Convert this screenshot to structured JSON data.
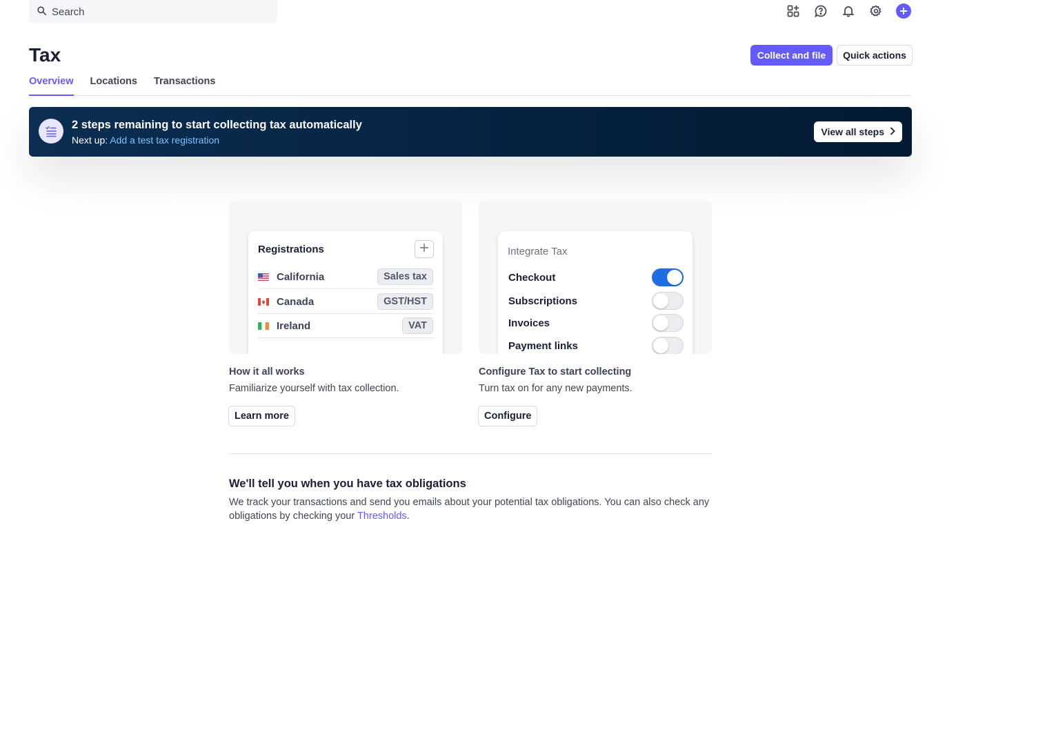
{
  "search": {
    "placeholder": "Search"
  },
  "top_icons": [
    "apps-add-icon",
    "help-icon",
    "bell-icon",
    "gear-icon",
    "plus-circle-icon"
  ],
  "header": {
    "title": "Tax",
    "primary_button": "Collect and file",
    "secondary_button": "Quick actions"
  },
  "tabs": [
    {
      "label": "Overview",
      "active": true
    },
    {
      "label": "Locations",
      "active": false
    },
    {
      "label": "Transactions",
      "active": false
    }
  ],
  "banner": {
    "title": "2 steps remaining to start collecting tax automatically",
    "next_prefix": "Next up: ",
    "next_link": "Add a test tax registration",
    "button": "View all steps"
  },
  "registrations": {
    "title": "Registrations",
    "rows": [
      {
        "name": "California",
        "tag": "Sales tax",
        "flag": "us"
      },
      {
        "name": "Canada",
        "tag": "GST/HST",
        "flag": "ca"
      },
      {
        "name": "Ireland",
        "tag": "VAT",
        "flag": "ie"
      }
    ]
  },
  "integrate": {
    "title": "Integrate Tax",
    "rows": [
      {
        "label": "Checkout",
        "on": true
      },
      {
        "label": "Subscriptions",
        "on": false
      },
      {
        "label": "Invoices",
        "on": false
      },
      {
        "label": "Payment links",
        "on": false
      }
    ]
  },
  "cards": {
    "left": {
      "heading": "How it all works",
      "desc": "Familiarize yourself with tax collection.",
      "button": "Learn more"
    },
    "right": {
      "heading": "Configure Tax to start collecting",
      "desc": "Turn tax on for any new payments.",
      "button": "Configure"
    }
  },
  "obligations": {
    "title": "We'll tell you when you have tax obligations",
    "text": "We track your transactions and send you emails about your potential tax obligations. You can also check any obligations by checking your ",
    "link": "Thresholds",
    "suffix": "."
  },
  "colors": {
    "accent": "#635bff",
    "banner": "#062241",
    "toggle_on": "#1d6ee5"
  }
}
